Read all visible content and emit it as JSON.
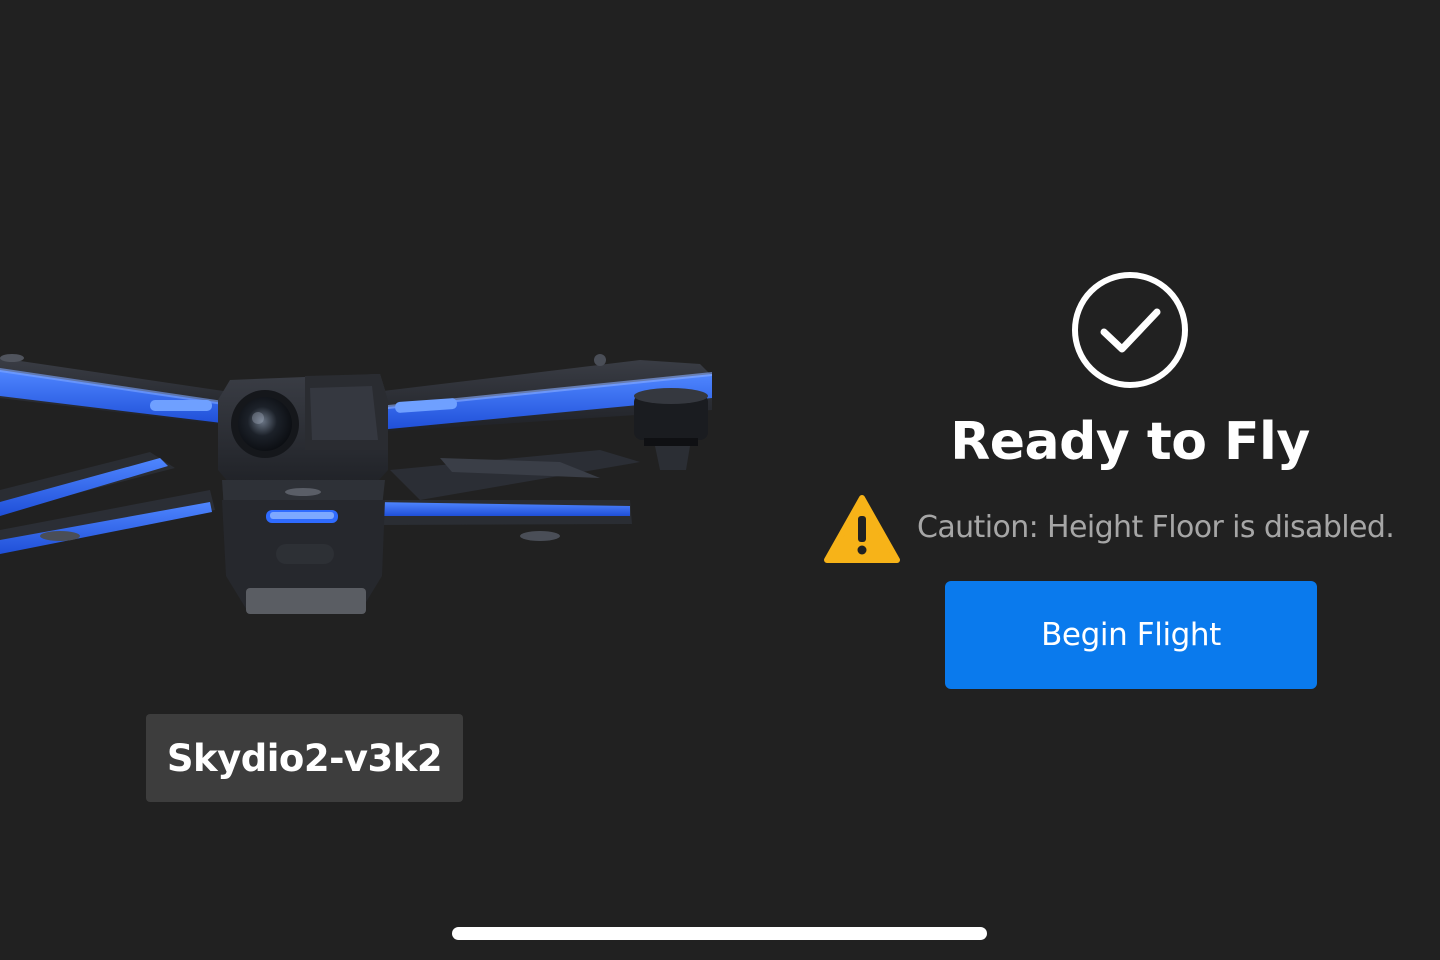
{
  "device": {
    "name": "Skydio2-v3k2",
    "image_icon": "drone-image",
    "accent_color": "#2f6bff"
  },
  "status": {
    "icon": "check-circle-icon",
    "title": "Ready to Fly"
  },
  "caution": {
    "icon": "warning-triangle-icon",
    "icon_color": "#f7b318",
    "text": "Caution: Height Floor is disabled."
  },
  "actions": {
    "begin_label": "Begin Flight",
    "begin_color": "#0a7aed"
  }
}
